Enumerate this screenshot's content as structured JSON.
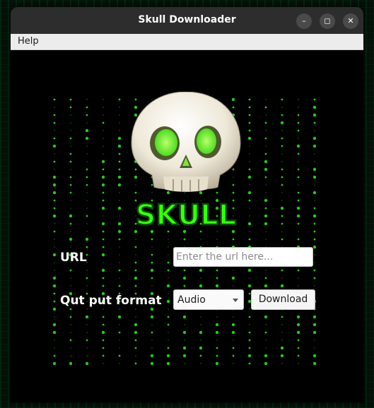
{
  "window": {
    "title": "Skull Downloader"
  },
  "controls": {
    "minimize": "–",
    "maximize": "◻",
    "close": "✕"
  },
  "menu": {
    "help": "Help"
  },
  "logo": {
    "text": "SKULL"
  },
  "form": {
    "url_label": "URL",
    "url_placeholder": "Enter the url here...",
    "url_value": "",
    "format_label": "Qut put format",
    "format_selected": "Audio",
    "download_label": "Download"
  },
  "colors": {
    "accent": "#39ff14",
    "dot": "#2bd41f"
  }
}
